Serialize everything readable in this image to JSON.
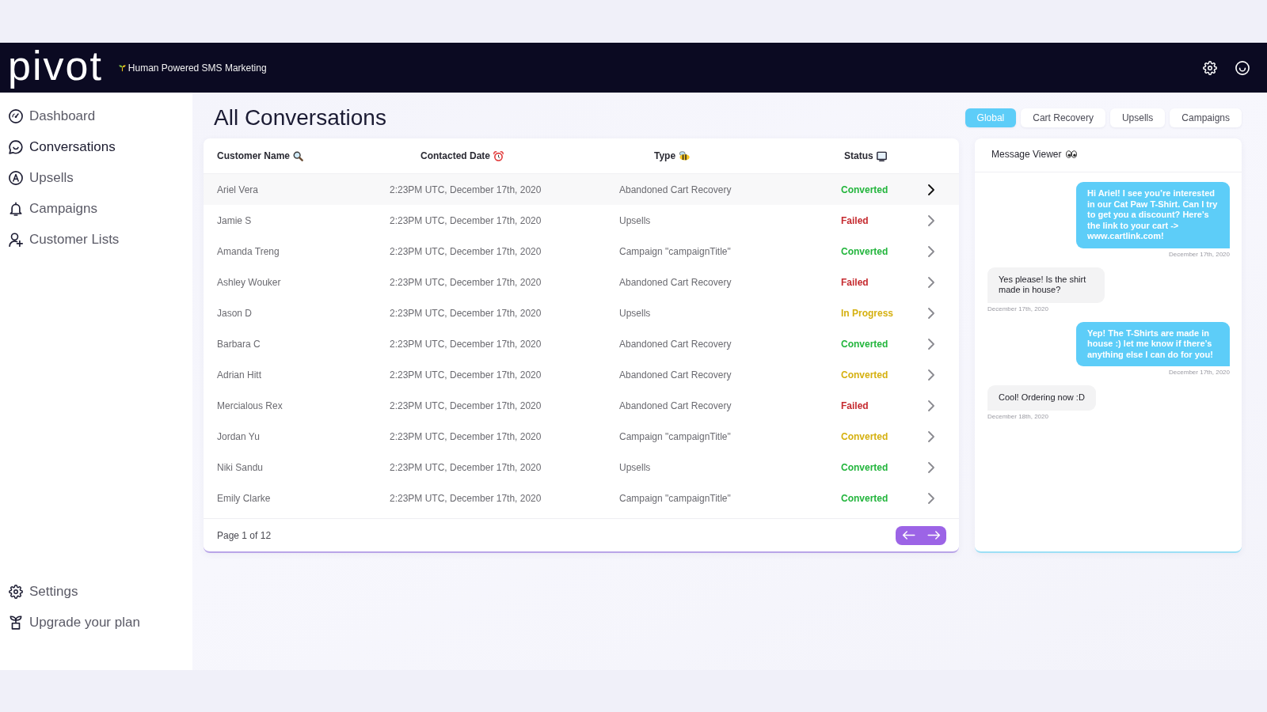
{
  "header": {
    "logo": "pivot",
    "tagline": "Human Powered SMS Marketing"
  },
  "sidebar": {
    "items": [
      {
        "label": "Dashboard",
        "selected": false
      },
      {
        "label": "Conversations",
        "selected": true
      },
      {
        "label": "Upsells",
        "selected": false
      },
      {
        "label": "Campaigns",
        "selected": false
      },
      {
        "label": "Customer Lists",
        "selected": false
      }
    ],
    "bottom_items": [
      {
        "label": "Settings",
        "selected": false
      },
      {
        "label": "Upgrade your plan",
        "selected": false
      }
    ]
  },
  "page_title": "All Conversations",
  "filters": [
    {
      "label": "Global",
      "selected": true
    },
    {
      "label": "Cart Recovery",
      "selected": false
    },
    {
      "label": "Upsells",
      "selected": false
    },
    {
      "label": "Campaigns",
      "selected": false
    }
  ],
  "table": {
    "columns": [
      {
        "label": "Customer Name"
      },
      {
        "label": "Contacted Date"
      },
      {
        "label": "Type"
      },
      {
        "label": "Status"
      }
    ],
    "rows": [
      {
        "name": "Ariel Vera",
        "date": "2:23PM UTC, December 17th, 2020",
        "type": "Abandoned Cart Recovery",
        "status": "Converted",
        "color": "#22b53c",
        "selected": true
      },
      {
        "name": "Jamie S",
        "date": "2:23PM UTC, December 17th, 2020",
        "type": "Upsells",
        "status": "Failed",
        "color": "#c52a2f",
        "selected": false
      },
      {
        "name": "Amanda Treng",
        "date": "2:23PM UTC, December 17th, 2020",
        "type": "Campaign \"campaignTitle\"",
        "status": "Converted",
        "color": "#22b53c",
        "selected": false
      },
      {
        "name": "Ashley Wouker",
        "date": "2:23PM UTC, December 17th, 2020",
        "type": "Abandoned Cart Recovery",
        "status": "Failed",
        "color": "#c52a2f",
        "selected": false
      },
      {
        "name": "Jason D",
        "date": "2:23PM UTC, December 17th, 2020",
        "type": "Upsells",
        "status": "In Progress",
        "color": "#d5b00f",
        "selected": false
      },
      {
        "name": "Barbara C",
        "date": "2:23PM UTC, December 17th, 2020",
        "type": "Abandoned Cart Recovery",
        "status": "Converted",
        "color": "#22b53c",
        "selected": false
      },
      {
        "name": "Adrian Hitt",
        "date": "2:23PM UTC, December 17th, 2020",
        "type": "Abandoned Cart Recovery",
        "status": "Converted",
        "color": "#d5b00f",
        "selected": false
      },
      {
        "name": "Mercialous Rex",
        "date": "2:23PM UTC, December 17th, 2020",
        "type": "Abandoned Cart Recovery",
        "status": "Failed",
        "color": "#c52a2f",
        "selected": false
      },
      {
        "name": "Jordan Yu",
        "date": "2:23PM UTC, December 17th, 2020",
        "type": "Campaign \"campaignTitle\"",
        "status": "Converted",
        "color": "#d5b00f",
        "selected": false
      },
      {
        "name": "Niki Sandu",
        "date": "2:23PM UTC, December 17th, 2020",
        "type": "Upsells",
        "status": "Converted",
        "color": "#22b53c",
        "selected": false
      },
      {
        "name": "Emily Clarke",
        "date": "2:23PM UTC, December 17th, 2020",
        "type": "Campaign \"campaignTitle\"",
        "status": "Converted",
        "color": "#22b53c",
        "selected": false
      }
    ],
    "footer": {
      "page": "Page 1 of 12"
    }
  },
  "message_viewer": {
    "title": "Message Viewer",
    "messages": [
      {
        "kind": "outgoing",
        "text": "Hi Ariel! I see you’re interested in our Cat Paw T-Shirt. Can I try to get you a discount? Here’s the link to your cart -> www.cartlink.com!",
        "date": "December 17th, 2020"
      },
      {
        "kind": "incoming",
        "text": "Yes please! Is the shirt made in house?",
        "date": "December 17th, 2020"
      },
      {
        "kind": "outgoing",
        "text": "Yep! The T-Shirts are made in house :) let me know if there’s anything else I can do for you!",
        "date": "December 17th, 2020"
      },
      {
        "kind": "incoming",
        "text": "Cool! Ordering now :D",
        "date": "December 18th, 2020"
      }
    ]
  }
}
